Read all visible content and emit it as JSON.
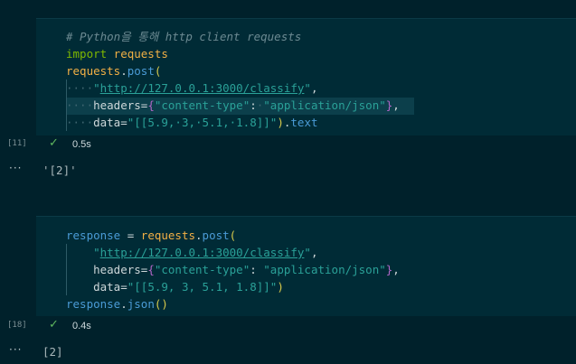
{
  "cells": [
    {
      "exec_count": "[11]",
      "timing": "0.5s",
      "lines": [
        [
          {
            "t": "# Python을 통해 http client requests",
            "c": "c-comment"
          }
        ],
        [
          {
            "t": "import",
            "c": "c-kw"
          },
          {
            "t": " requests",
            "c": "c-id"
          }
        ],
        [
          {
            "t": "requests",
            "c": "c-id"
          },
          {
            "t": ".",
            "c": "c-white"
          },
          {
            "t": "post",
            "c": "c-var"
          },
          {
            "t": "(",
            "c": "c-paren"
          }
        ],
        [
          {
            "t": "····",
            "c": "dot"
          },
          {
            "t": "\"",
            "c": "c-str"
          },
          {
            "t": "http://127.0.0.1:3000/classify",
            "c": "c-url"
          },
          {
            "t": "\"",
            "c": "c-str"
          },
          {
            "t": ",",
            "c": "c-white"
          }
        ],
        [
          {
            "t": "····",
            "c": "dot"
          },
          {
            "t": "headers",
            "c": "c-white"
          },
          {
            "t": "=",
            "c": "c-white"
          },
          {
            "t": "{",
            "c": "c-brace"
          },
          {
            "t": "\"content-type\"",
            "c": "c-str"
          },
          {
            "t": ":",
            "c": "c-white"
          },
          {
            "t": "·",
            "c": "dot"
          },
          {
            "t": "\"application/json\"",
            "c": "c-str"
          },
          {
            "t": "}",
            "c": "c-brace"
          },
          {
            "t": ",",
            "c": "c-white"
          }
        ],
        [
          {
            "t": "····",
            "c": "dot"
          },
          {
            "t": "data",
            "c": "c-white"
          },
          {
            "t": "=",
            "c": "c-white"
          },
          {
            "t": "\"[[5.9,·3,·5.1,·1.8]]\"",
            "c": "c-str"
          },
          {
            "t": ")",
            "c": "c-paren"
          },
          {
            "t": ".",
            "c": "c-white"
          },
          {
            "t": "text",
            "c": "c-var"
          }
        ]
      ],
      "output": "'[2]'"
    },
    {
      "exec_count": "[18]",
      "timing": "0.4s",
      "lines": [
        [
          {
            "t": "response",
            "c": "c-var"
          },
          {
            "t": " = ",
            "c": "c-white"
          },
          {
            "t": "requests",
            "c": "c-id"
          },
          {
            "t": ".",
            "c": "c-white"
          },
          {
            "t": "post",
            "c": "c-var"
          },
          {
            "t": "(",
            "c": "c-paren"
          }
        ],
        [
          {
            "t": "    ",
            "c": "c-white"
          },
          {
            "t": "\"",
            "c": "c-str"
          },
          {
            "t": "http://127.0.0.1:3000/classify",
            "c": "c-url"
          },
          {
            "t": "\"",
            "c": "c-str"
          },
          {
            "t": ",",
            "c": "c-white"
          }
        ],
        [
          {
            "t": "    ",
            "c": "c-white"
          },
          {
            "t": "headers",
            "c": "c-white"
          },
          {
            "t": "=",
            "c": "c-white"
          },
          {
            "t": "{",
            "c": "c-brace"
          },
          {
            "t": "\"content-type\"",
            "c": "c-str"
          },
          {
            "t": ": ",
            "c": "c-white"
          },
          {
            "t": "\"application/json\"",
            "c": "c-str"
          },
          {
            "t": "}",
            "c": "c-brace"
          },
          {
            "t": ",",
            "c": "c-white"
          }
        ],
        [
          {
            "t": "    ",
            "c": "c-white"
          },
          {
            "t": "data",
            "c": "c-white"
          },
          {
            "t": "=",
            "c": "c-white"
          },
          {
            "t": "\"[[5.9, 3, 5.1, 1.8]]\"",
            "c": "c-str"
          },
          {
            "t": ")",
            "c": "c-paren"
          }
        ],
        [
          {
            "t": "response",
            "c": "c-var"
          },
          {
            "t": ".",
            "c": "c-white"
          },
          {
            "t": "json",
            "c": "c-var"
          },
          {
            "t": "(",
            "c": "c-paren"
          },
          {
            "t": ")",
            "c": "c-paren"
          }
        ]
      ],
      "output": "[2]"
    }
  ],
  "icons": {
    "check": "✓",
    "more": "···"
  },
  "colors": {
    "background": "#00212b",
    "code_background": "#002b36",
    "check_green": "#5fb85f"
  }
}
